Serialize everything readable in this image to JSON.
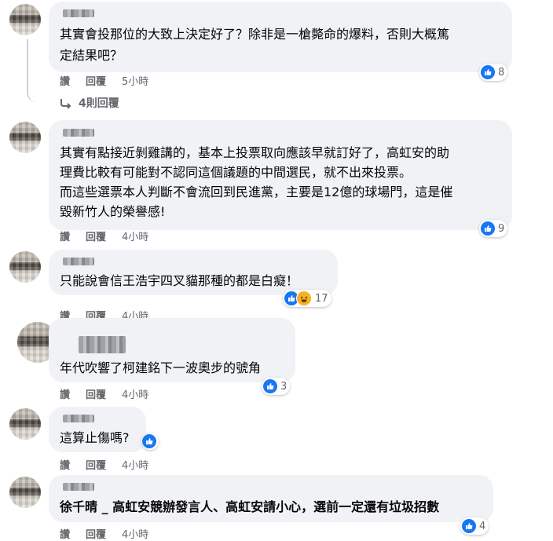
{
  "comments": [
    {
      "lines": [
        "其實會投那位的大致上決定好了？除非是一槍斃命的爆料，否則大概篤",
        "定結果吧？"
      ],
      "actions": {
        "like": "讚",
        "reply": "回覆",
        "time": "5小時"
      },
      "reaction_count": "8",
      "view_replies": "4則回覆"
    },
    {
      "lines": [
        "其實有點接近剝雞講的，基本上投票取向應該早就訂好了，高虹安的助",
        "理費比較有可能對不認同這個議題的中間選民，就不出來投票。",
        "而這些選票本人判斷不會流回到民進黨，主要是12億的球場門，這是催",
        "毀新竹人的榮譽感!"
      ],
      "actions": {
        "like": "讚",
        "reply": "回覆",
        "time": "4小時"
      },
      "reaction_count": "9"
    },
    {
      "lines": [
        "只能說會信王浩宇四叉貓那種的都是白癡！"
      ],
      "actions": {
        "like": "讚",
        "reply": "回覆",
        "time": "4小時"
      },
      "reaction_count": "17"
    },
    {
      "lines": [
        "年代吹響了柯建銘下一波奧步的號角"
      ],
      "actions": {
        "like": "讚",
        "reply": "回覆",
        "time": "4小時"
      },
      "reaction_count": "3"
    },
    {
      "lines": [
        "這算止傷嗎?"
      ],
      "actions": {
        "like": "讚",
        "reply": "回覆",
        "time": "4小時"
      },
      "reaction_count": ""
    },
    {
      "lines": [
        "徐千晴 _ 高虹安競辦發言人、高虹安請小心，選前一定還有垃圾招數"
      ],
      "actions": {
        "like": "讚",
        "reply": "回覆",
        "time": "4小時"
      },
      "reaction_count": "4"
    }
  ],
  "icons": {
    "like": "like-icon",
    "haha": "haha-icon",
    "reply_arrow": "reply-arrow-icon"
  },
  "colors": {
    "like_blue": "#1877f2",
    "bubble": "#f0f2f5",
    "secondary_text": "#65676b"
  }
}
